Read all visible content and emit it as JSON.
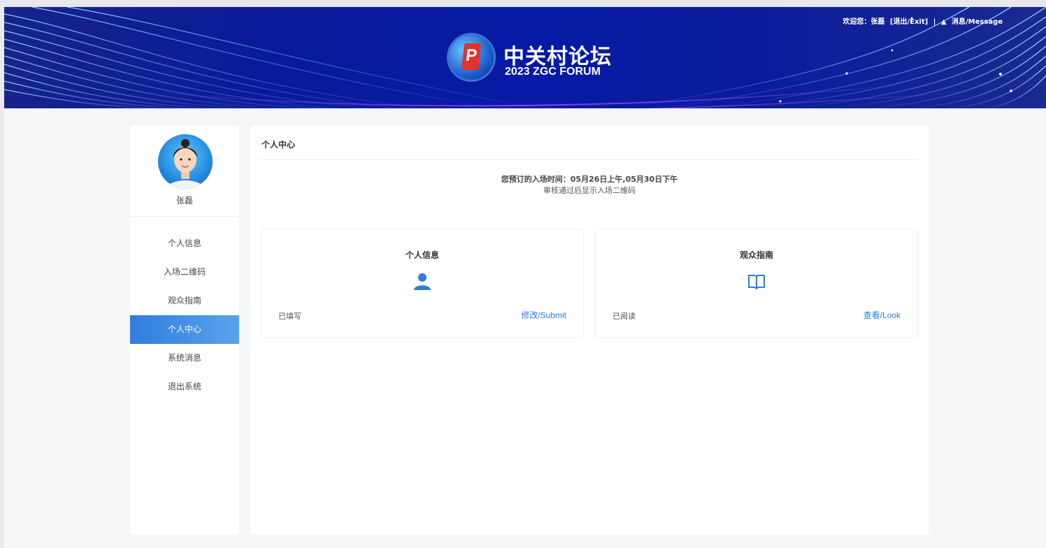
{
  "header": {
    "welcome": "欢迎您：张磊",
    "exit_link": "[退出/Exit]",
    "separator": "|",
    "bell_icon": "bell-icon",
    "message_link": "消息/Message",
    "logo_title": "中关村论坛",
    "logo_subtitle": "2023 ZGC FORUM",
    "brand_color": "#061aa6"
  },
  "sidebar": {
    "username": "张磊",
    "items": [
      {
        "label": "个人信息",
        "active": false
      },
      {
        "label": "入场二维码",
        "active": false
      },
      {
        "label": "观众指南",
        "active": false
      },
      {
        "label": "个人中心",
        "active": true
      },
      {
        "label": "系统消息",
        "active": false
      },
      {
        "label": "退出系统",
        "active": false
      }
    ],
    "active_color": "#2f7de0"
  },
  "main": {
    "title": "个人中心",
    "notice_time": "您预订的入场时间：05月26日上午,05月30日下午",
    "notice_sub": "审核通过后显示入场二维码",
    "cards": [
      {
        "title": "个人信息",
        "icon": "user-icon",
        "status": "已填写",
        "action": "修改/Submit"
      },
      {
        "title": "观众指南",
        "icon": "book-icon",
        "status": "已阅读",
        "action": "查看/Look"
      }
    ],
    "accent_color": "#2f7de0"
  }
}
